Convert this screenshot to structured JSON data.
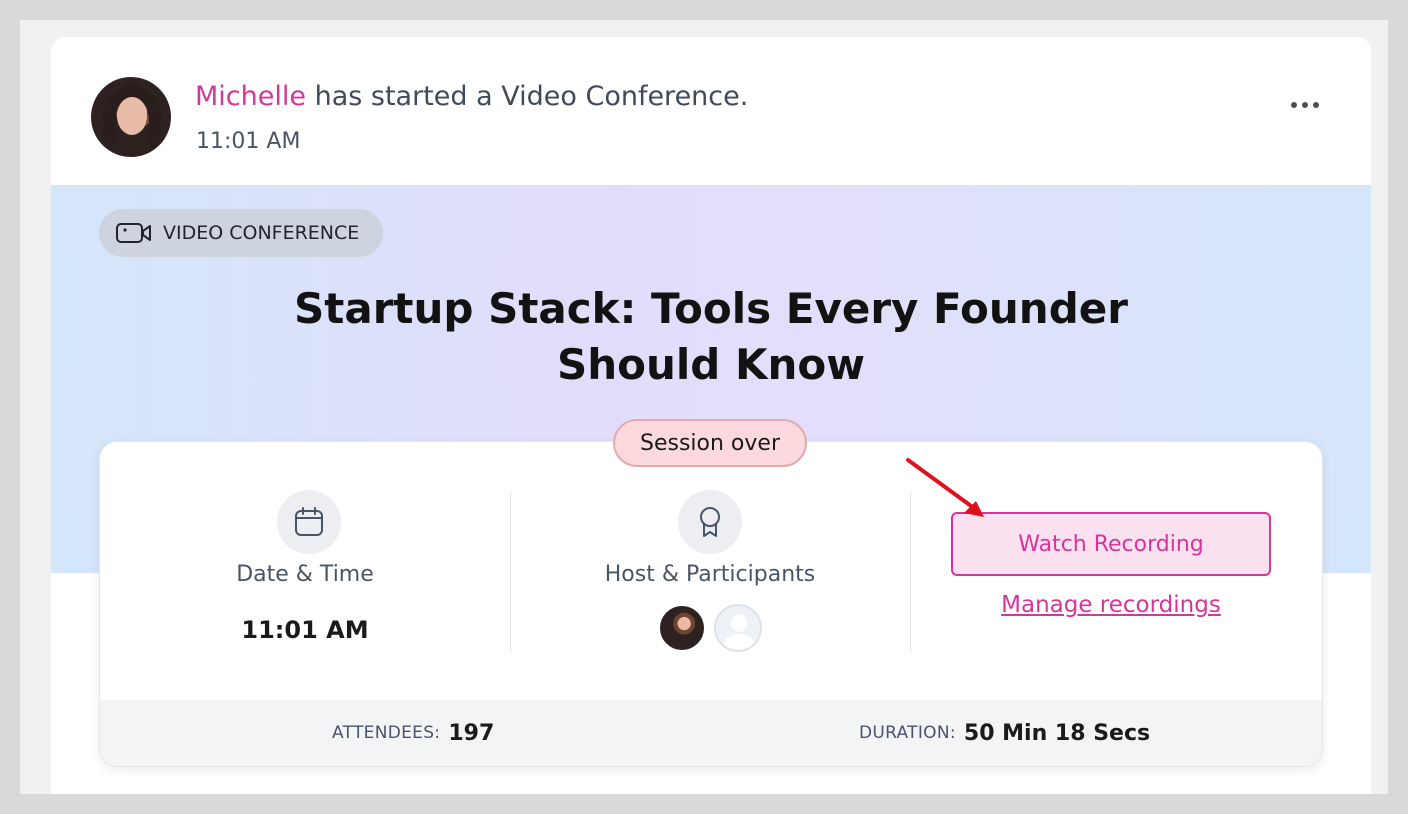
{
  "post": {
    "author": "Michelle",
    "action": "has started a Video Conference.",
    "time": "11:01 AM"
  },
  "banner": {
    "chip_label": "VIDEO CONFERENCE",
    "title": "Startup Stack: Tools Every Founder Should Know"
  },
  "session": {
    "status": "Session over",
    "date_time_label": "Date & Time",
    "date_time_value": "11:01 AM",
    "host_label": "Host & Participants",
    "watch_label": "Watch Recording",
    "manage_label": "Manage recordings"
  },
  "stats": {
    "attendees_label": "ATTENDEES:",
    "attendees_value": "197",
    "duration_label": "DURATION:",
    "duration_value": "50 Min 18 Secs"
  },
  "colors": {
    "accent": "#d6369c",
    "badge_bg": "#fbd9dc",
    "arrow": "#e0101e"
  },
  "icons": {
    "more": "more-horizontal-icon",
    "chip": "video-camera-icon",
    "date": "calendar-icon",
    "host": "award-icon"
  }
}
